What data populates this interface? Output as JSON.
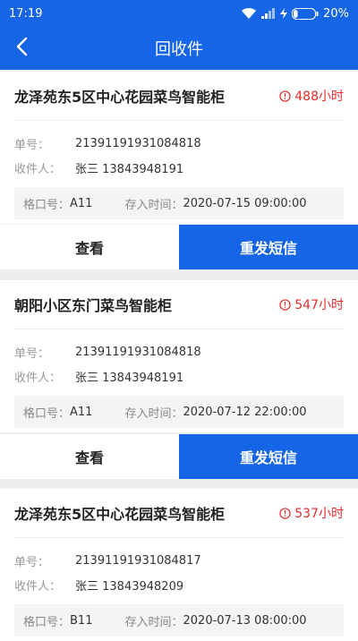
{
  "status_bar": {
    "time": "17:19",
    "battery_percent": "20%",
    "battery_level": 0.2
  },
  "header": {
    "title": "回收件"
  },
  "labels": {
    "tracking": "单号：",
    "recipient": "收件人：",
    "slot": "格口号：",
    "stored_time": "存入时间：",
    "view": "查看",
    "resend": "重发短信"
  },
  "cards": [
    {
      "locker": "龙泽苑东5区中心花园菜鸟智能柜",
      "hours": "488小时",
      "tracking_no": "21391191931084818",
      "recipient": "张三 13843948191",
      "slot": "A11",
      "stored_time": "2020-07-15 09:00:00"
    },
    {
      "locker": "朝阳小区东门菜鸟智能柜",
      "hours": "547小时",
      "tracking_no": "21391191931084818",
      "recipient": "张三 13843948191",
      "slot": "A11",
      "stored_time": "2020-07-12 22:00:00"
    },
    {
      "locker": "龙泽苑东5区中心花园菜鸟智能柜",
      "hours": "537小时",
      "tracking_no": "21391191931084817",
      "recipient": "张三 13843948209",
      "slot": "B11",
      "stored_time": "2020-07-13 08:00:00"
    }
  ],
  "colors": {
    "primary": "#1565e6",
    "alert": "#e02d2d"
  },
  "icons": {
    "back": "chevron-left-icon",
    "alert": "alert-circle-icon",
    "wifi": "wifi-icon",
    "signal": "signal-icon",
    "battery": "battery-icon"
  }
}
